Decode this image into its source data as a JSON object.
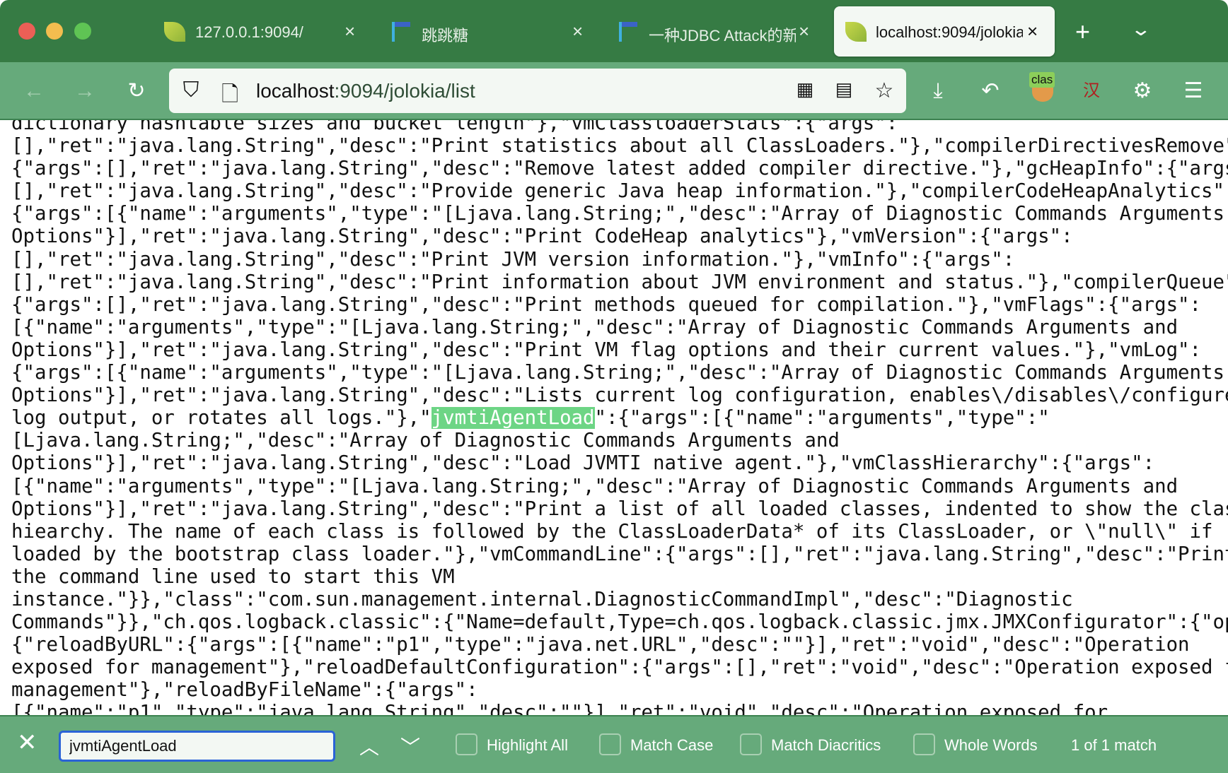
{
  "tabs": [
    {
      "title": "127.0.0.1:9094/",
      "icon": "spring-leaf-icon"
    },
    {
      "title": "跳跳糖",
      "icon": "tiaotiaotang-icon"
    },
    {
      "title": "一种JDBC Attack的新",
      "icon": "tiaotiaotang-icon"
    },
    {
      "title": "localhost:9094/jolokia",
      "icon": "spring-leaf-icon",
      "active": true
    }
  ],
  "url": {
    "host": "localhost",
    "path": ":9094/jolokia/list"
  },
  "extension_badge": "clas",
  "translate_label": "汉",
  "content_lines": [
    "dictionary hashtable sizes and bucket length\"},\"vmClassloaderStats\":{\"args\":",
    "[],\"ret\":\"java.lang.String\",\"desc\":\"Print statistics about all ClassLoaders.\"},\"compilerDirectivesRemove\":",
    "{\"args\":[],\"ret\":\"java.lang.String\",\"desc\":\"Remove latest added compiler directive.\"},\"gcHeapInfo\":{\"args\":",
    "[],\"ret\":\"java.lang.String\",\"desc\":\"Provide generic Java heap information.\"},\"compilerCodeHeapAnalytics\":",
    "{\"args\":[{\"name\":\"arguments\",\"type\":\"[Ljava.lang.String;\",\"desc\":\"Array of Diagnostic Commands Arguments and",
    "Options\"}],\"ret\":\"java.lang.String\",\"desc\":\"Print CodeHeap analytics\"},\"vmVersion\":{\"args\":",
    "[],\"ret\":\"java.lang.String\",\"desc\":\"Print JVM version information.\"},\"vmInfo\":{\"args\":",
    "[],\"ret\":\"java.lang.String\",\"desc\":\"Print information about JVM environment and status.\"},\"compilerQueue\":",
    "{\"args\":[],\"ret\":\"java.lang.String\",\"desc\":\"Print methods queued for compilation.\"},\"vmFlags\":{\"args\":",
    "[{\"name\":\"arguments\",\"type\":\"[Ljava.lang.String;\",\"desc\":\"Array of Diagnostic Commands Arguments and",
    "Options\"}],\"ret\":\"java.lang.String\",\"desc\":\"Print VM flag options and their current values.\"},\"vmLog\":",
    "{\"args\":[{\"name\":\"arguments\",\"type\":\"[Ljava.lang.String;\",\"desc\":\"Array of Diagnostic Commands Arguments and",
    "Options\"}],\"ret\":\"java.lang.String\",\"desc\":\"Lists current log configuration, enables\\/disables\\/configures a"
  ],
  "match_line": {
    "before": "log output, or rotates all logs.\"},\"",
    "match": "jvmtiAgentLoad",
    "after": "\":{\"args\":[{\"name\":\"arguments\",\"type\":\""
  },
  "content_lines_after": [
    "[Ljava.lang.String;\",\"desc\":\"Array of Diagnostic Commands Arguments and",
    "Options\"}],\"ret\":\"java.lang.String\",\"desc\":\"Load JVMTI native agent.\"},\"vmClassHierarchy\":{\"args\":",
    "[{\"name\":\"arguments\",\"type\":\"[Ljava.lang.String;\",\"desc\":\"Array of Diagnostic Commands Arguments and",
    "Options\"}],\"ret\":\"java.lang.String\",\"desc\":\"Print a list of all loaded classes, indented to show the class",
    "hiearchy. The name of each class is followed by the ClassLoaderData* of its ClassLoader, or \\\"null\\\" if",
    "loaded by the bootstrap class loader.\"},\"vmCommandLine\":{\"args\":[],\"ret\":\"java.lang.String\",\"desc\":\"Print",
    "the command line used to start this VM",
    "instance.\"}},\"class\":\"com.sun.management.internal.DiagnosticCommandImpl\",\"desc\":\"Diagnostic",
    "Commands\"}},\"ch.qos.logback.classic\":{\"Name=default,Type=ch.qos.logback.classic.jmx.JMXConfigurator\":{\"op\":",
    "{\"reloadByURL\":{\"args\":[{\"name\":\"p1\",\"type\":\"java.net.URL\",\"desc\":\"\"}],\"ret\":\"void\",\"desc\":\"Operation",
    "exposed for management\"},\"reloadDefaultConfiguration\":{\"args\":[],\"ret\":\"void\",\"desc\":\"Operation exposed for",
    "management\"},\"reloadByFileName\":{\"args\":",
    "[{\"name\":\"p1\",\"type\":\"java.lang.String\",\"desc\":\"\"}],\"ret\":\"void\",\"desc\":\"Operation exposed for"
  ],
  "findbar": {
    "query": "jvmtiAgentLoad",
    "options": [
      {
        "label": "Highlight All",
        "checked": false
      },
      {
        "label": "Match Case",
        "checked": false
      },
      {
        "label": "Match Diacritics",
        "checked": false
      },
      {
        "label": "Whole Words",
        "checked": false
      }
    ],
    "status": "1 of 1 match"
  },
  "colors": {
    "tabbar": "#367b44",
    "toolbar": "#66aa7b",
    "highlight": "#6dd585",
    "find_focus": "#2a63d6"
  }
}
